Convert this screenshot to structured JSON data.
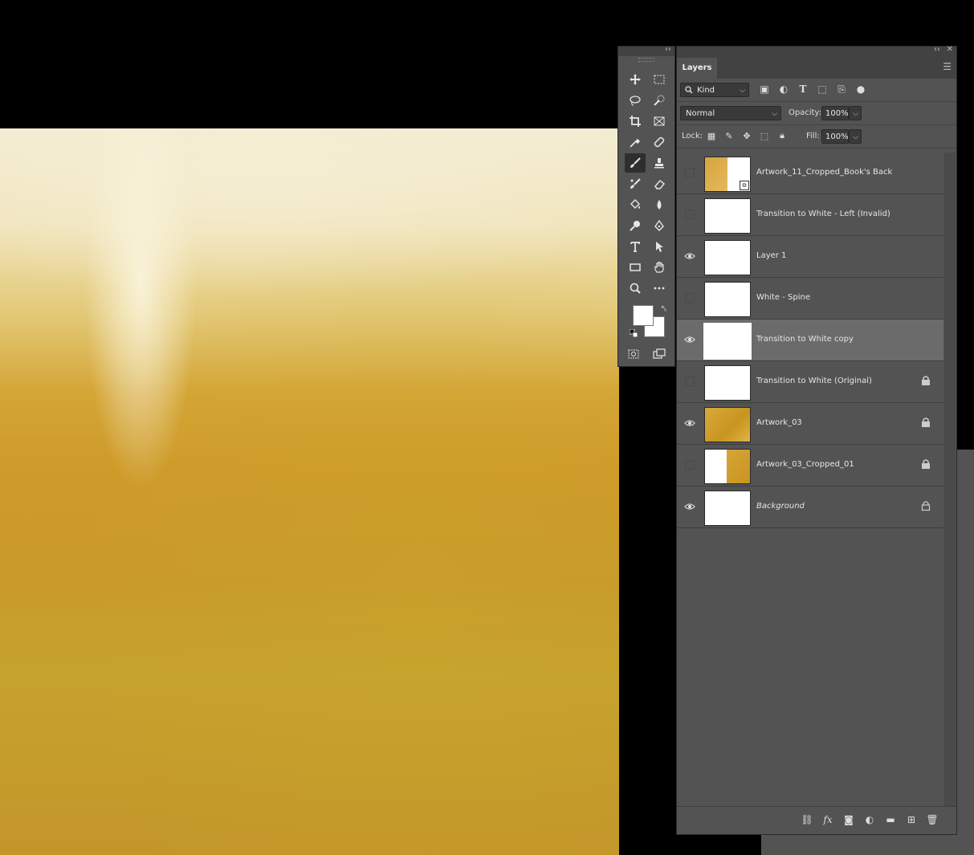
{
  "layers_panel": {
    "tab_label": "Layers",
    "filter_kind": "Kind",
    "blend_mode": "Normal",
    "opacity_label": "Opacity:",
    "opacity_value": "100%",
    "lock_label": "Lock:",
    "fill_label": "Fill:",
    "fill_value": "100%",
    "layers": [
      {
        "name": "Artwork_11_Cropped_Book's Back",
        "visible": false,
        "locked": false
      },
      {
        "name": "Transition to White - Left (Invalid)",
        "visible": false,
        "locked": false
      },
      {
        "name": "Layer 1",
        "visible": true,
        "locked": false
      },
      {
        "name": "White - Spine",
        "visible": false,
        "locked": false
      },
      {
        "name": "Transition to White copy",
        "visible": true,
        "locked": false,
        "selected": true
      },
      {
        "name": "Transition to White (Original)",
        "visible": false,
        "locked": true
      },
      {
        "name": "Artwork_03",
        "visible": true,
        "locked": true
      },
      {
        "name": "Artwork_03_Cropped_01",
        "visible": false,
        "locked": true
      },
      {
        "name": "Background",
        "visible": true,
        "locked": true
      }
    ]
  },
  "icons": {
    "eye": "eye-icon",
    "lock": "lock-icon"
  },
  "colors": {
    "panel_bg": "#535353",
    "selected_row": "#6b6b6b",
    "canvas_gold": "#c99a2a"
  }
}
